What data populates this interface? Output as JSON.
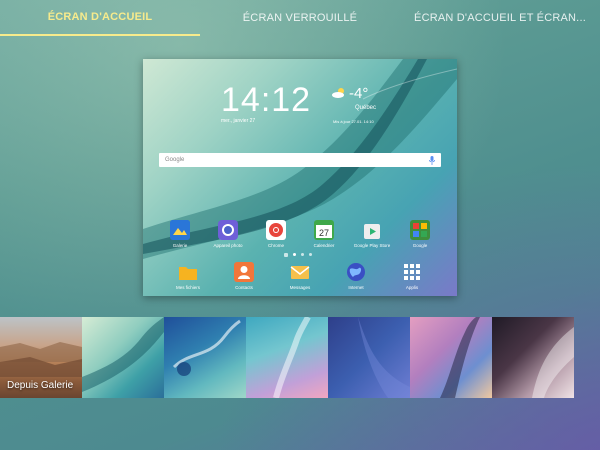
{
  "tabs": [
    {
      "label": "ÉCRAN D'ACCUEIL",
      "selected": true
    },
    {
      "label": "ÉCRAN VERROUILLÉ",
      "selected": false
    },
    {
      "label": "ÉCRAN D'ACCUEIL ET ÉCRAN...",
      "selected": false
    }
  ],
  "colors": {
    "accent": "#f7eb8c"
  },
  "preview": {
    "clock": "14:12",
    "date": "mer., janvier 27",
    "weather": {
      "icon": "partly-cloudy-icon",
      "temperature": "-4°",
      "city": "Québec",
      "updated": "Mis à jour 27.01. 14:10"
    },
    "search": {
      "logo": "Google",
      "mic_icon": "mic-icon"
    },
    "apps_row": [
      {
        "label": "Galerie",
        "icon": "gallery-icon"
      },
      {
        "label": "Appareil photo",
        "icon": "camera-icon"
      },
      {
        "label": "Chrome",
        "icon": "chrome-icon"
      },
      {
        "label": "Calendrier",
        "icon": "calendar-icon",
        "badge": "27"
      },
      {
        "label": "Google Play Store",
        "icon": "play-store-icon"
      },
      {
        "label": "Google",
        "icon": "google-folder-icon"
      }
    ],
    "dock": [
      {
        "label": "Mes fichiers",
        "icon": "folder-icon"
      },
      {
        "label": "Contacts",
        "icon": "contacts-icon"
      },
      {
        "label": "Messages",
        "icon": "messages-icon"
      },
      {
        "label": "Internet",
        "icon": "globe-icon"
      },
      {
        "label": "Applis",
        "icon": "apps-grid-icon"
      }
    ]
  },
  "wallpapers": [
    {
      "caption": "Depuis Galerie"
    },
    {
      "caption": ""
    },
    {
      "caption": ""
    },
    {
      "caption": ""
    },
    {
      "caption": ""
    },
    {
      "caption": ""
    },
    {
      "caption": ""
    },
    {
      "caption": ""
    }
  ]
}
